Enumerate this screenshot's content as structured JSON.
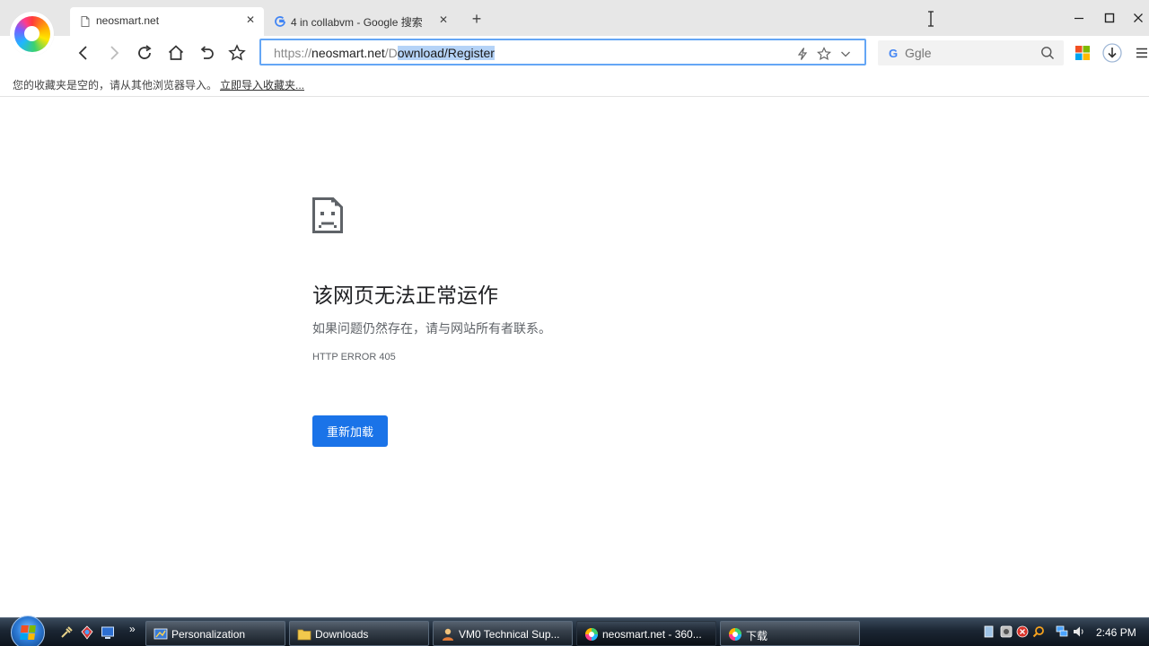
{
  "browser": {
    "tabs": [
      {
        "label": "neosmart.net",
        "active": true
      },
      {
        "label": "4 in collabvm - Google 搜索",
        "active": false
      }
    ],
    "url": {
      "scheme": "https://",
      "host": "neosmart.net",
      "slash_d": "/D",
      "selected": "ownload/Register"
    },
    "search": {
      "placeholder": "Ggle",
      "engine_icon": "G"
    },
    "bookmarks_bar": {
      "message": "您的收藏夹是空的，请从其他浏览器导入。",
      "import_link": "立即导入收藏夹..."
    }
  },
  "error_page": {
    "title": "该网页无法正常运作",
    "description": "如果问题仍然存在，请与网站所有者联系。",
    "code": "HTTP ERROR 405",
    "reload_label": "重新加载"
  },
  "taskbar": {
    "quicklaunch_more": "»",
    "buttons": [
      {
        "label": "Personalization",
        "active": false
      },
      {
        "label": "Downloads",
        "active": false
      },
      {
        "label": "VM0 Technical Sup...",
        "active": false
      },
      {
        "label": "neosmart.net - 360...",
        "active": true
      },
      {
        "label": "下载",
        "active": false
      }
    ],
    "clock": "2:46 PM"
  },
  "colors": {
    "accent": "#1a73e8",
    "omnibox_border": "#64a6f5",
    "selection": "#b5d3f7"
  }
}
